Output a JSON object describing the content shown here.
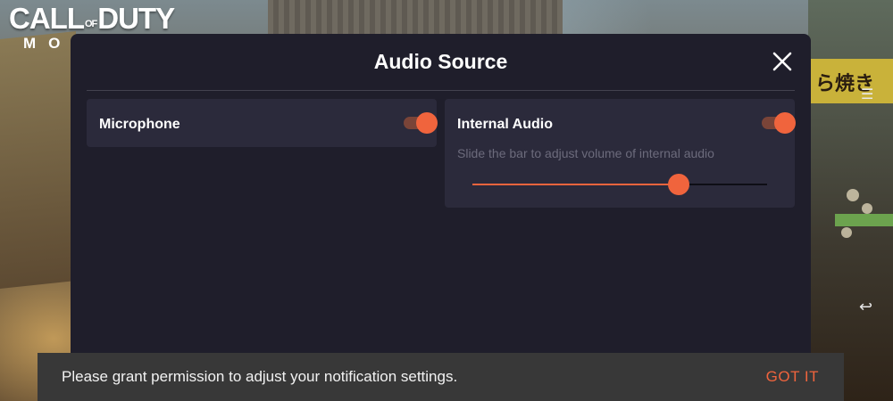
{
  "background": {
    "logo_line1_a": "CALL",
    "logo_line1_small": "OF",
    "logo_line1_b": "DUTY",
    "logo_line2": "MOBILE",
    "sign_text": "ら焼き"
  },
  "dialog": {
    "title": "Audio Source",
    "close_icon": "close-icon"
  },
  "microphone": {
    "label": "Microphone",
    "enabled": true
  },
  "internal_audio": {
    "label": "Internal Audio",
    "enabled": true,
    "description": "Slide the bar to adjust volume of internal audio",
    "volume_percent": 70
  },
  "toast": {
    "message": "Please grant permission to adjust your notification settings.",
    "action_label": "GOT IT"
  },
  "colors": {
    "accent": "#f0643d",
    "dialog_bg": "#1f1e2b",
    "card_bg": "#2b2a3b",
    "toast_bg": "#383838"
  }
}
